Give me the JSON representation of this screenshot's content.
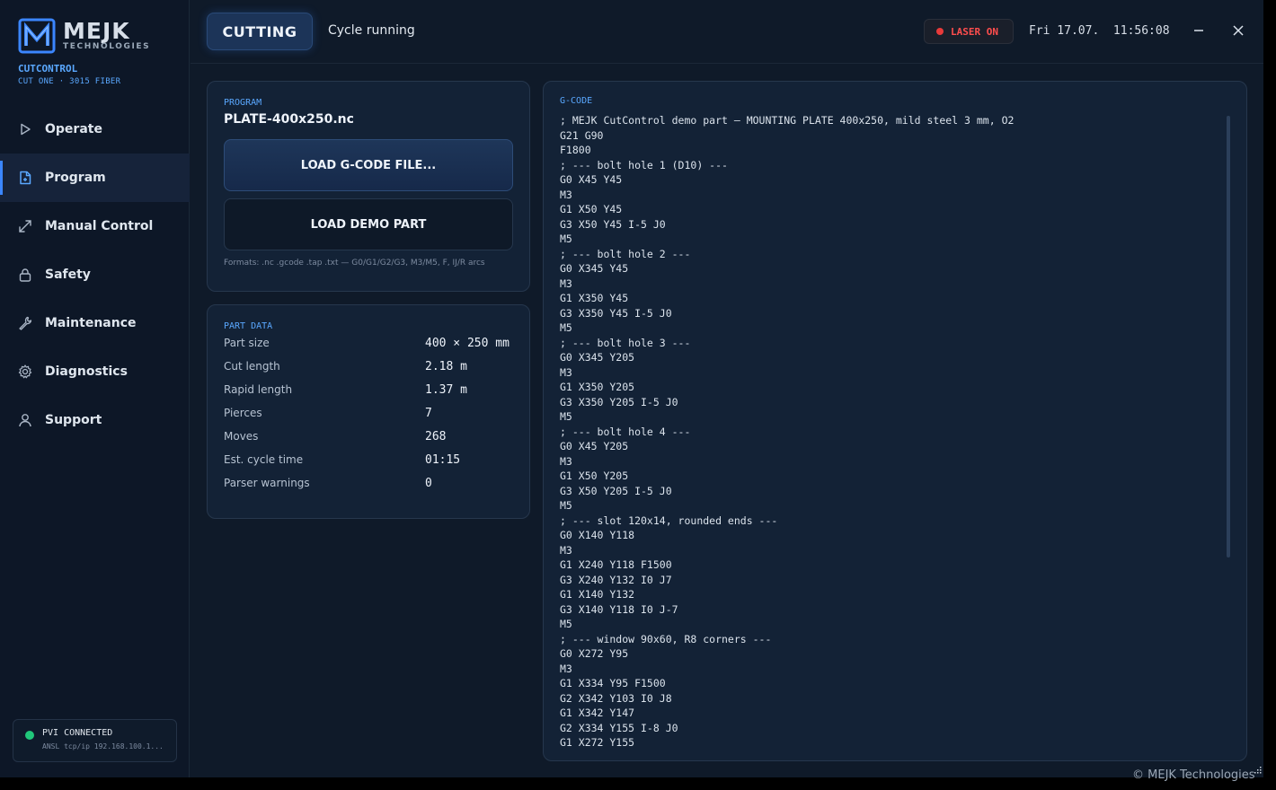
{
  "brand": {
    "name": "MEJK",
    "tagline": "TECHNOLOGIES",
    "product": "CUTCONTROL",
    "model": "CUT ONE · 3015 FIBER"
  },
  "nav": {
    "items": [
      {
        "label": "Operate",
        "icon": "play-icon",
        "active": false
      },
      {
        "label": "Program",
        "icon": "file-icon",
        "active": true
      },
      {
        "label": "Manual Control",
        "icon": "arrows-icon",
        "active": false
      },
      {
        "label": "Safety",
        "icon": "lock-icon",
        "active": false
      },
      {
        "label": "Maintenance",
        "icon": "wrench-icon",
        "active": false
      },
      {
        "label": "Diagnostics",
        "icon": "gear-icon",
        "active": false
      },
      {
        "label": "Support",
        "icon": "user-icon",
        "active": false
      }
    ]
  },
  "connection": {
    "status": "PVI CONNECTED",
    "address": "ANSL tcp/ip 192.168.100.1..."
  },
  "topbar": {
    "state": "CUTTING",
    "state_text": "Cycle running",
    "laser": "LASER ON",
    "clock": "Fri 17.07.  11:56:08"
  },
  "program": {
    "title": "PROGRAM",
    "name": "PLATE-400x250.nc",
    "load_file_label": "LOAD G-CODE FILE...",
    "load_demo_label": "LOAD DEMO PART",
    "formats": "Formats: .nc .gcode .tap .txt — G0/G1/G2/G3, M3/M5, F, IJ/R arcs"
  },
  "part_data": {
    "title": "PART DATA",
    "rows": [
      {
        "label": "Part size",
        "value": "400 × 250 mm"
      },
      {
        "label": "Cut length",
        "value": "2.18 m"
      },
      {
        "label": "Rapid length",
        "value": "1.37 m"
      },
      {
        "label": "Pierces",
        "value": "7"
      },
      {
        "label": "Moves",
        "value": "268"
      },
      {
        "label": "Est. cycle time",
        "value": "01:15"
      },
      {
        "label": "Parser warnings",
        "value": "0"
      }
    ]
  },
  "gcode": {
    "title": "G-CODE",
    "lines": [
      "; MEJK CutControl demo part — MOUNTING PLATE 400x250, mild steel 3 mm, O2",
      "G21 G90",
      "F1800",
      "; --- bolt hole 1 (D10) ---",
      "G0 X45 Y45",
      "M3",
      "G1 X50 Y45",
      "G3 X50 Y45 I-5 J0",
      "M5",
      "; --- bolt hole 2 ---",
      "G0 X345 Y45",
      "M3",
      "G1 X350 Y45",
      "G3 X350 Y45 I-5 J0",
      "M5",
      "; --- bolt hole 3 ---",
      "G0 X345 Y205",
      "M3",
      "G1 X350 Y205",
      "G3 X350 Y205 I-5 J0",
      "M5",
      "; --- bolt hole 4 ---",
      "G0 X45 Y205",
      "M3",
      "G1 X50 Y205",
      "G3 X50 Y205 I-5 J0",
      "M5",
      "; --- slot 120x14, rounded ends ---",
      "G0 X140 Y118",
      "M3",
      "G1 X240 Y118 F1500",
      "G3 X240 Y132 I0 J7",
      "G1 X140 Y132",
      "G3 X140 Y118 I0 J-7",
      "M5",
      "; --- window 90x60, R8 corners ---",
      "G0 X272 Y95",
      "M3",
      "G1 X334 Y95 F1500",
      "G2 X342 Y103 I0 J8",
      "G1 X342 Y147",
      "G2 X334 Y155 I-8 J0",
      "G1 X272 Y155"
    ]
  },
  "footer": {
    "copyright": "© MEJK Technologies"
  },
  "colors": {
    "accent": "#3b86ff",
    "label_blue": "#5aa8ff",
    "laser_red": "#ff4d4d",
    "connected_green": "#20c77a",
    "background": "#0f1a29"
  }
}
